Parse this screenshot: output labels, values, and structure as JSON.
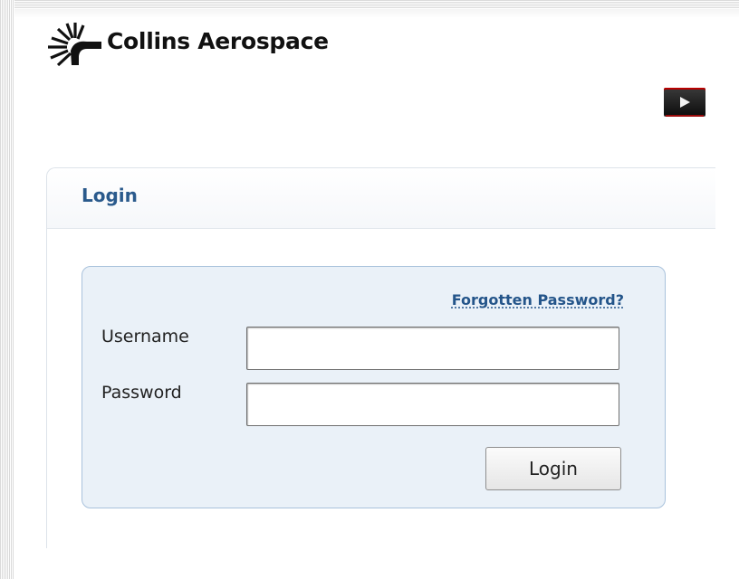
{
  "brand": {
    "logo_text": "Collins Aerospace",
    "logo_icon": "sunburst-logo-icon"
  },
  "video": {
    "icon": "play-video-icon"
  },
  "login_panel": {
    "title": "Login",
    "forgot_password_link": "Forgotten Password?",
    "username_label": "Username",
    "username_value": "",
    "password_label": "Password",
    "password_value": "",
    "submit_label": "Login"
  },
  "colors": {
    "title_blue": "#2a5a8c",
    "link_blue": "#24558a",
    "form_background": "#eaf1f8",
    "form_border": "#a9c2dc"
  }
}
